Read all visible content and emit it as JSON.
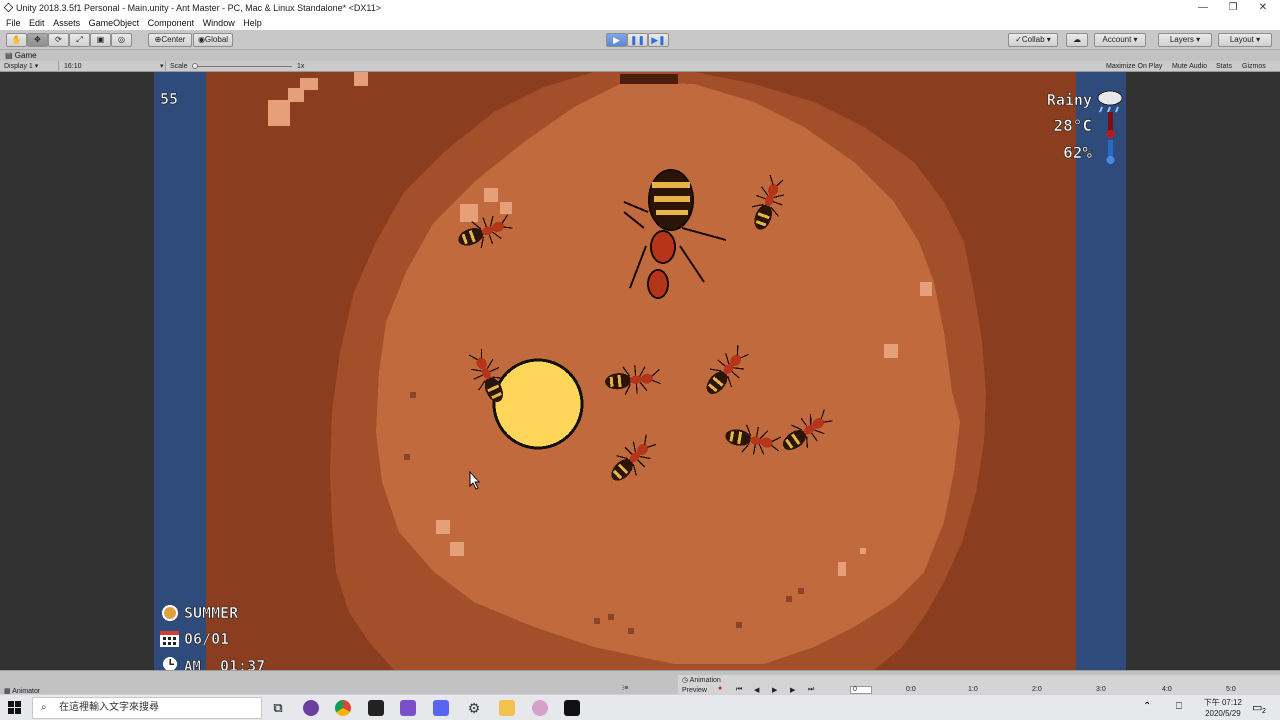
{
  "window": {
    "title": "Unity 2018.3.5f1 Personal - Main.unity - Ant Master - PC, Mac & Linux Standalone* <DX11>",
    "controls": [
      "—",
      "❐",
      "✕"
    ]
  },
  "menu": [
    "File",
    "Edit",
    "Assets",
    "GameObject",
    "Component",
    "Window",
    "Help"
  ],
  "toolbar": {
    "tools": [
      "hand-icon",
      "move-icon",
      "rotate-icon",
      "scale-icon",
      "rect-icon",
      "transform-icon"
    ],
    "pivot": "Center",
    "space": "Global",
    "collab": "Collab",
    "account": "Account",
    "layers": "Layers",
    "layout": "Layout"
  },
  "game_view": {
    "tab_label": "Game",
    "display": "Display 1",
    "aspect": "16:10",
    "scale_label": "Scale",
    "scale_value": "1x",
    "options": [
      "Maximize On Play",
      "Mute Audio",
      "Stats",
      "Gizmos"
    ]
  },
  "hud": {
    "counter": "55",
    "weather": "Rainy",
    "temperature": "28°C",
    "humidity": "62%",
    "season": "SUMMER",
    "date": "06/01",
    "ampm": "AM",
    "time": "01:37"
  },
  "animation": {
    "tab_label": "Animation",
    "preview": "Preview",
    "frame": "0",
    "ticks": [
      "0:0",
      "1:0",
      "2:0",
      "3:0",
      "4:0",
      "5:0"
    ]
  },
  "animator_tab": "Animator",
  "taskbar": {
    "search_placeholder": "在這裡輸入文字來搜尋",
    "time": "下午 07:12",
    "date": "2020/5/29",
    "notifications": "2"
  },
  "colors": {
    "water": "#2e4b7c",
    "soil_outer": "#8b3e1f",
    "soil_mid": "#a3502a",
    "soil_inner": "#c06a3d",
    "food": "#ffd55a"
  }
}
